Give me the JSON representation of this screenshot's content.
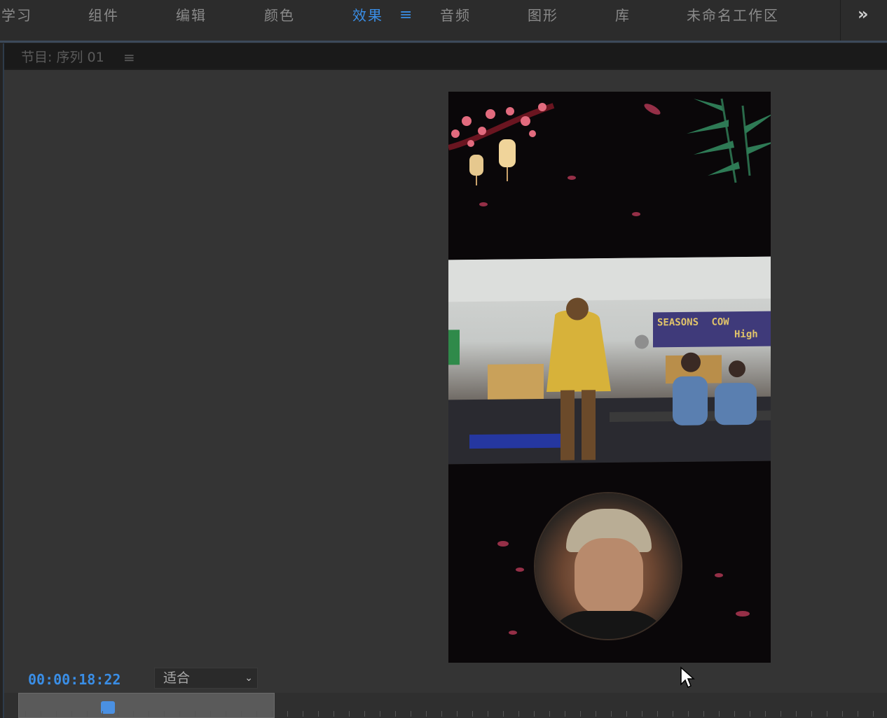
{
  "workspaces": {
    "items": [
      "学习",
      "组件",
      "编辑",
      "颜色",
      "效果",
      "音频",
      "图形",
      "库",
      "未命名工作区"
    ],
    "active_index": 4,
    "menu_icon": "≡",
    "more_icon": "»"
  },
  "panel": {
    "title": "节目: 序列 01",
    "menu_icon": "≡"
  },
  "program": {
    "timecode": "00:00:18:22",
    "fit": {
      "selected": "适合",
      "chevron": "⌄"
    },
    "sign": {
      "line1": "SEASONS",
      "line2": "COW",
      "line3": "High"
    },
    "playhead_position": 0.15
  },
  "colors": {
    "accent": "#3a8ee6"
  }
}
